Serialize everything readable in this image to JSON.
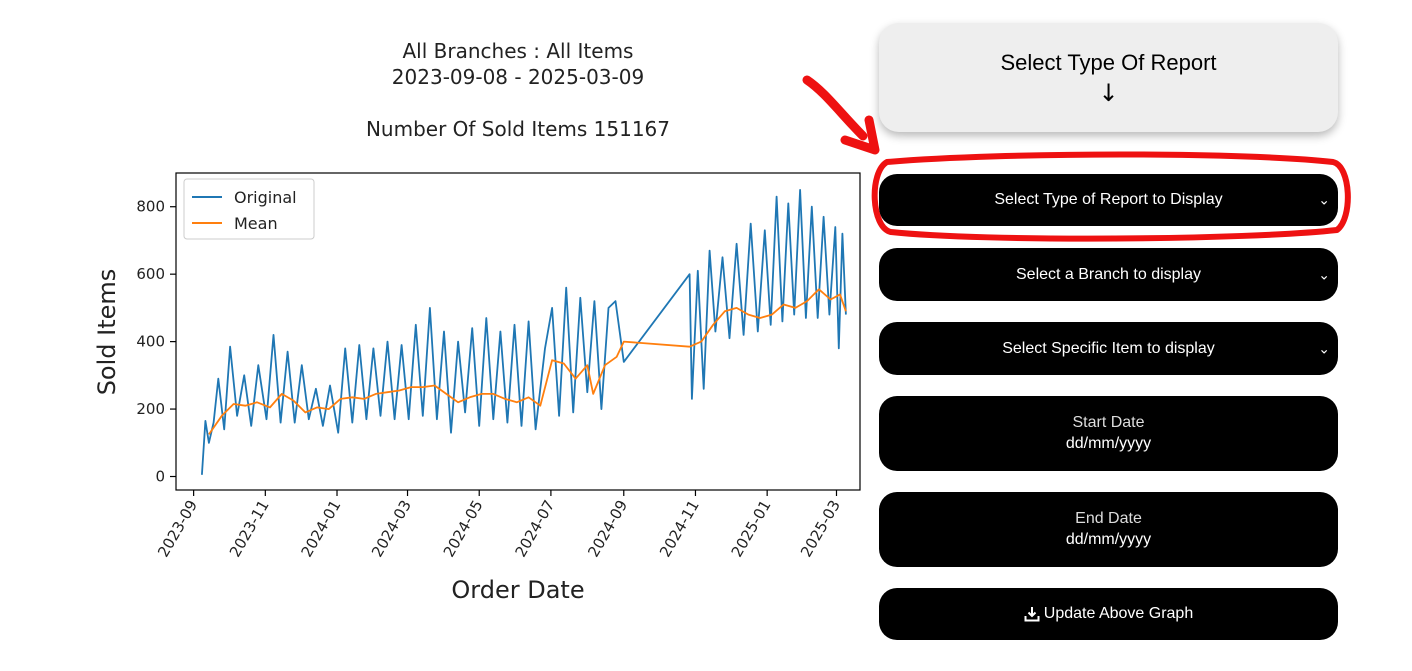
{
  "chart_data": {
    "type": "line",
    "title": [
      "All Branches : All Items",
      "2023-09-08 - 2025-03-09",
      "",
      "Number Of Sold Items 151167"
    ],
    "xlabel": "Order Date",
    "ylabel": "Sold Items",
    "xlim": [
      "2023-08-17",
      "2025-03-21"
    ],
    "ylim": [
      -40,
      900
    ],
    "yticks": [
      0,
      200,
      400,
      600,
      800
    ],
    "xticks": [
      "2023-09",
      "2023-11",
      "2024-01",
      "2024-03",
      "2024-05",
      "2024-07",
      "2024-09",
      "2024-11",
      "2025-01",
      "2025-03"
    ],
    "legend_position": "upper-left",
    "grid": false,
    "series": [
      {
        "name": "Original",
        "color": "#1f77b4",
        "x": [
          "2023-09-08",
          "2023-09-11",
          "2023-09-14",
          "2023-09-18",
          "2023-09-22",
          "2023-09-27",
          "2023-10-02",
          "2023-10-08",
          "2023-10-14",
          "2023-10-20",
          "2023-10-26",
          "2023-11-02",
          "2023-11-08",
          "2023-11-14",
          "2023-11-20",
          "2023-11-26",
          "2023-12-02",
          "2023-12-08",
          "2023-12-14",
          "2023-12-20",
          "2023-12-26",
          "2024-01-02",
          "2024-01-08",
          "2024-01-14",
          "2024-01-20",
          "2024-01-26",
          "2024-02-01",
          "2024-02-07",
          "2024-02-13",
          "2024-02-19",
          "2024-02-25",
          "2024-03-02",
          "2024-03-08",
          "2024-03-14",
          "2024-03-20",
          "2024-03-26",
          "2024-04-01",
          "2024-04-07",
          "2024-04-13",
          "2024-04-19",
          "2024-04-25",
          "2024-05-01",
          "2024-05-07",
          "2024-05-13",
          "2024-05-19",
          "2024-05-25",
          "2024-05-31",
          "2024-06-06",
          "2024-06-12",
          "2024-06-18",
          "2024-06-26",
          "2024-07-02",
          "2024-07-08",
          "2024-07-14",
          "2024-07-20",
          "2024-07-26",
          "2024-08-01",
          "2024-08-07",
          "2024-08-13",
          "2024-08-19",
          "2024-08-25",
          "2024-09-01",
          "2024-10-27",
          "2024-10-29",
          "2024-11-03",
          "2024-11-08",
          "2024-11-13",
          "2024-11-18",
          "2024-11-24",
          "2024-11-30",
          "2024-12-06",
          "2024-12-12",
          "2024-12-18",
          "2024-12-24",
          "2024-12-30",
          "2025-01-04",
          "2025-01-09",
          "2025-01-14",
          "2025-01-19",
          "2025-01-24",
          "2025-01-29",
          "2025-02-03",
          "2025-02-08",
          "2025-02-13",
          "2025-02-18",
          "2025-02-23",
          "2025-02-28",
          "2025-03-03",
          "2025-03-06",
          "2025-03-09"
        ],
        "y": [
          5,
          165,
          100,
          160,
          290,
          140,
          385,
          180,
          300,
          150,
          330,
          170,
          420,
          160,
          370,
          160,
          330,
          170,
          260,
          150,
          270,
          130,
          380,
          160,
          390,
          170,
          380,
          180,
          400,
          170,
          390,
          170,
          450,
          180,
          500,
          170,
          430,
          130,
          400,
          190,
          440,
          150,
          470,
          170,
          430,
          160,
          450,
          150,
          460,
          140,
          380,
          500,
          180,
          560,
          190,
          530,
          250,
          520,
          200,
          500,
          520,
          340,
          600,
          230,
          610,
          260,
          670,
          430,
          650,
          410,
          690,
          420,
          750,
          430,
          730,
          450,
          830,
          460,
          810,
          480,
          850,
          470,
          800,
          470,
          770,
          480,
          740,
          380,
          720,
          480
        ]
      },
      {
        "name": "Mean",
        "color": "#ff7f0e",
        "x": [
          "2023-09-14",
          "2023-09-25",
          "2023-10-05",
          "2023-10-15",
          "2023-10-25",
          "2023-11-05",
          "2023-11-15",
          "2023-11-25",
          "2023-12-05",
          "2023-12-15",
          "2023-12-25",
          "2024-01-04",
          "2024-01-14",
          "2024-01-24",
          "2024-02-03",
          "2024-02-13",
          "2024-02-23",
          "2024-03-04",
          "2024-03-14",
          "2024-03-24",
          "2024-04-03",
          "2024-04-13",
          "2024-04-23",
          "2024-05-03",
          "2024-05-13",
          "2024-05-23",
          "2024-06-02",
          "2024-06-12",
          "2024-06-22",
          "2024-07-02",
          "2024-07-12",
          "2024-07-22",
          "2024-08-01",
          "2024-08-06",
          "2024-08-16",
          "2024-08-26",
          "2024-09-01",
          "2024-10-27",
          "2024-11-06",
          "2024-11-16",
          "2024-11-26",
          "2024-12-06",
          "2024-12-16",
          "2024-12-26",
          "2025-01-05",
          "2025-01-15",
          "2025-01-25",
          "2025-02-04",
          "2025-02-14",
          "2025-02-24",
          "2025-03-04",
          "2025-03-09"
        ],
        "y": [
          125,
          180,
          215,
          210,
          220,
          205,
          245,
          225,
          190,
          205,
          200,
          230,
          235,
          230,
          245,
          250,
          255,
          265,
          265,
          270,
          245,
          220,
          235,
          245,
          245,
          230,
          220,
          235,
          210,
          345,
          335,
          290,
          330,
          245,
          330,
          355,
          400,
          385,
          400,
          450,
          490,
          500,
          480,
          470,
          480,
          510,
          500,
          520,
          555,
          525,
          540,
          490
        ]
      }
    ]
  },
  "report_header": {
    "title": "Select Type Of Report",
    "arrow_icon": "↓"
  },
  "controls": {
    "report_type": {
      "label": "Select Type of Report to Display"
    },
    "branch": {
      "label": "Select a Branch to display"
    },
    "item": {
      "label": "Select Specific Item to display"
    },
    "start_date": {
      "label": "Start Date",
      "value": "dd/mm/yyyy"
    },
    "end_date": {
      "label": "End Date",
      "value": "dd/mm/yyyy"
    },
    "update_button": {
      "label": "Update Above Graph",
      "icon": "download-icon"
    }
  },
  "chevron": "⌄",
  "colors": {
    "annotation": "#ee1111",
    "control_bg": "#000000",
    "header_bg": "#eeeeee"
  }
}
